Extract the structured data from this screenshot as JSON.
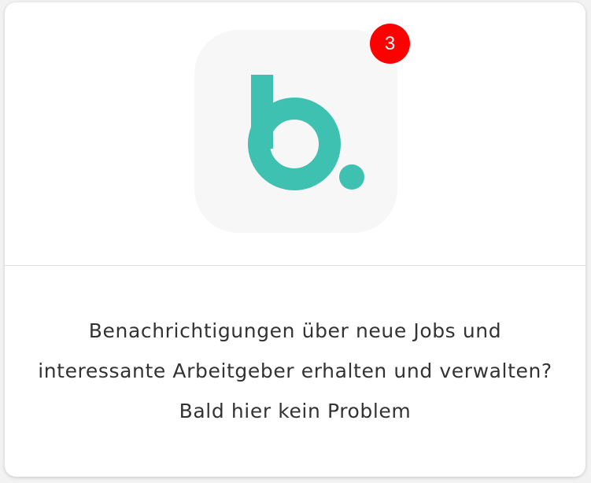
{
  "card": {
    "badge_count": "3",
    "message": "Benachrichtigungen über neue Jobs und interessante Arbeitgeber erhalten und verwalten? Bald hier kein Problem"
  },
  "app_icon": {
    "name": "b-logo-icon",
    "brand_color": "#3ec1b0",
    "tile_color": "#f7f7f7"
  },
  "badge": {
    "color": "#ff0000"
  }
}
